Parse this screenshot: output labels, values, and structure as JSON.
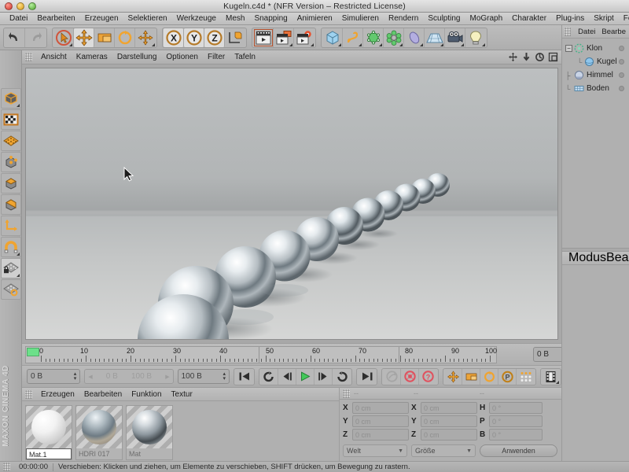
{
  "window": {
    "title": "Kugeln.c4d * (NFR Version – Restricted License)",
    "traffic": [
      "close-button",
      "minimize-button",
      "zoom-button"
    ]
  },
  "menubar": {
    "items": [
      "Datei",
      "Bearbeiten",
      "Erzeugen",
      "Selektieren",
      "Werkzeuge",
      "Mesh",
      "Snapping",
      "Animieren",
      "Simulieren",
      "Rendern",
      "Sculpting",
      "MoGraph",
      "Charakter",
      "Plug-ins",
      "Skript",
      "Fer"
    ]
  },
  "toolbar": {
    "groups": [
      {
        "name": "undo-redo",
        "buttons": [
          {
            "name": "undo-button",
            "icon": "undo-icon"
          },
          {
            "name": "redo-button",
            "icon": "redo-icon"
          }
        ]
      },
      {
        "name": "transform-tools",
        "buttons": [
          {
            "name": "select-tool-button",
            "icon": "live-selection-icon"
          },
          {
            "name": "move-tool-button",
            "icon": "move-icon",
            "selected": true
          },
          {
            "name": "scale-tool-button",
            "icon": "scale-icon"
          },
          {
            "name": "rotate-tool-button",
            "icon": "rotate-icon"
          },
          {
            "name": "world-move-button",
            "icon": "move-plus-icon"
          }
        ]
      },
      {
        "name": "axis-locks",
        "buttons": [
          {
            "name": "lock-x-button",
            "icon": "axis-x-icon",
            "label": "X"
          },
          {
            "name": "lock-y-button",
            "icon": "axis-y-icon",
            "label": "Y"
          },
          {
            "name": "lock-z-button",
            "icon": "axis-z-icon",
            "label": "Z"
          },
          {
            "name": "coordinate-system-button",
            "icon": "world-object-axis-icon"
          }
        ]
      },
      {
        "name": "render-tools",
        "buttons": [
          {
            "name": "render-view-button",
            "icon": "render-view-icon",
            "active": true
          },
          {
            "name": "render-region-button",
            "icon": "render-region-icon"
          },
          {
            "name": "render-settings-button",
            "icon": "render-settings-icon"
          }
        ]
      },
      {
        "name": "create-objects",
        "buttons": [
          {
            "name": "add-primitive-button",
            "icon": "cube-icon"
          },
          {
            "name": "add-spline-button",
            "icon": "spline-icon"
          },
          {
            "name": "add-generator-button",
            "icon": "generator-icon"
          },
          {
            "name": "add-deformer-button",
            "icon": "deformer-icon"
          },
          {
            "name": "add-environment-button",
            "icon": "sky-icon"
          },
          {
            "name": "add-scene-button",
            "icon": "floor-icon"
          },
          {
            "name": "add-camera-button",
            "icon": "camera-icon"
          },
          {
            "name": "add-light-button",
            "icon": "light-bulb-icon"
          }
        ]
      }
    ]
  },
  "left_palette": {
    "buttons": [
      {
        "name": "model-mode-button",
        "icon": "model-cube-icon"
      },
      {
        "name": "texture-mode-button",
        "icon": "texture-checker-icon"
      },
      {
        "name": "points-grid-button",
        "icon": "grid-icon"
      },
      {
        "name": "points-mode-button",
        "icon": "points-cube-icon"
      },
      {
        "name": "edges-mode-button",
        "icon": "edges-cube-icon"
      },
      {
        "name": "polygons-mode-button",
        "icon": "polygons-cube-icon"
      },
      {
        "name": "axis-mode-button",
        "icon": "axis-icon"
      },
      {
        "name": "snap-magnet-button",
        "icon": "magnet-icon"
      },
      {
        "name": "lock-workplane-button",
        "icon": "lock-plane-icon",
        "light": true
      },
      {
        "name": "workplane-rotate-button",
        "icon": "plane-rotate-icon"
      }
    ],
    "brand": "MAXON CINEMA 4D"
  },
  "viewport": {
    "menu": [
      "Ansicht",
      "Kameras",
      "Darstellung",
      "Optionen",
      "Filter",
      "Tafeln"
    ],
    "corner_icons": [
      {
        "name": "pan-view-icon"
      },
      {
        "name": "dolly-view-icon"
      },
      {
        "name": "orbit-view-icon"
      },
      {
        "name": "maximize-view-icon"
      }
    ],
    "scene": {
      "description": "Chrome spheres arranged in a diagonal line on a reflective floor",
      "sphere_count": 12
    }
  },
  "timeline": {
    "ticks": [
      "0",
      "10",
      "20",
      "30",
      "40",
      "50",
      "60",
      "70",
      "80",
      "90",
      "100"
    ],
    "range_start": 0,
    "range_end": 100,
    "current_frame_field": "0 B"
  },
  "transport": {
    "current_frame": "0 B",
    "preview_start": "0 B",
    "preview_end": "100 B",
    "document_end": "100 B",
    "buttons": [
      {
        "name": "goto-start-button",
        "icon": "skip-start-icon"
      },
      {
        "name": "loop-button",
        "icon": "loop-icon"
      },
      {
        "name": "step-back-button",
        "icon": "step-back-icon"
      },
      {
        "name": "play-button",
        "icon": "play-icon"
      },
      {
        "name": "step-forward-button",
        "icon": "step-forward-icon"
      },
      {
        "name": "play-reverse-button",
        "icon": "play-reverse-icon"
      },
      {
        "name": "goto-end-button",
        "icon": "skip-end-icon"
      },
      {
        "name": "autokey-button",
        "icon": "autokey-icon"
      },
      {
        "name": "record-button",
        "icon": "record-icon"
      },
      {
        "name": "keyframe-help-button",
        "icon": "question-icon"
      },
      {
        "name": "key-position-button",
        "icon": "key-move-icon"
      },
      {
        "name": "key-scale-button",
        "icon": "key-scale-icon"
      },
      {
        "name": "key-rotation-button",
        "icon": "key-rotate-icon"
      },
      {
        "name": "key-param-button",
        "icon": "key-param-icon"
      },
      {
        "name": "key-pla-button",
        "icon": "key-pla-icon"
      },
      {
        "name": "timeline-window-button",
        "icon": "filmstrip-icon"
      }
    ]
  },
  "material_manager": {
    "menu": [
      "Erzeugen",
      "Bearbeiten",
      "Funktion",
      "Textur"
    ],
    "materials": [
      {
        "name": "Mat.1",
        "selected": true,
        "swatch": "white-matte"
      },
      {
        "name": "HDRI 017",
        "selected": false,
        "swatch": "hdri-chrome"
      },
      {
        "name": "Mat",
        "selected": false,
        "swatch": "chrome"
      }
    ]
  },
  "coordinates": {
    "column_headers": [
      "--",
      "--",
      "--"
    ],
    "rows": [
      {
        "label_pos": "X",
        "value_pos": "0 cm",
        "label_size": "X",
        "value_size": "0 cm",
        "label_rot": "H",
        "value_rot": "0 °"
      },
      {
        "label_pos": "Y",
        "value_pos": "0 cm",
        "label_size": "Y",
        "value_size": "0 cm",
        "label_rot": "P",
        "value_rot": "0 °"
      },
      {
        "label_pos": "Z",
        "value_pos": "0 cm",
        "label_size": "Z",
        "value_size": "0 cm",
        "label_rot": "B",
        "value_rot": "0 °"
      }
    ],
    "system_select": "Welt",
    "mode_select": "Größe",
    "apply_button": "Anwenden"
  },
  "object_manager": {
    "menu": [
      "Datei",
      "Bearbe"
    ],
    "tree": [
      {
        "label": "Klon",
        "depth": 0,
        "icon": "cloner-icon",
        "expandable": true
      },
      {
        "label": "Kugel",
        "depth": 1,
        "icon": "sphere-icon",
        "expandable": false
      },
      {
        "label": "Himmel",
        "depth": 0,
        "icon": "sky-object-icon",
        "expandable": false
      },
      {
        "label": "Boden",
        "depth": 0,
        "icon": "floor-object-icon",
        "expandable": false
      }
    ]
  },
  "attribute_manager": {
    "menu": [
      "Modus",
      "Bearb"
    ]
  },
  "statusbar": {
    "time": "00:00:00",
    "message": "Verschieben: Klicken und ziehen, um Elemente zu verschieben, SHIFT drücken, um Bewegung zu rastern."
  },
  "colors": {
    "accent_orange": "#e08b22",
    "chrome": "#c9cdd0",
    "panel": "#b0b0b0",
    "play_green": "#43c85a",
    "record_red": "#e0515e"
  }
}
